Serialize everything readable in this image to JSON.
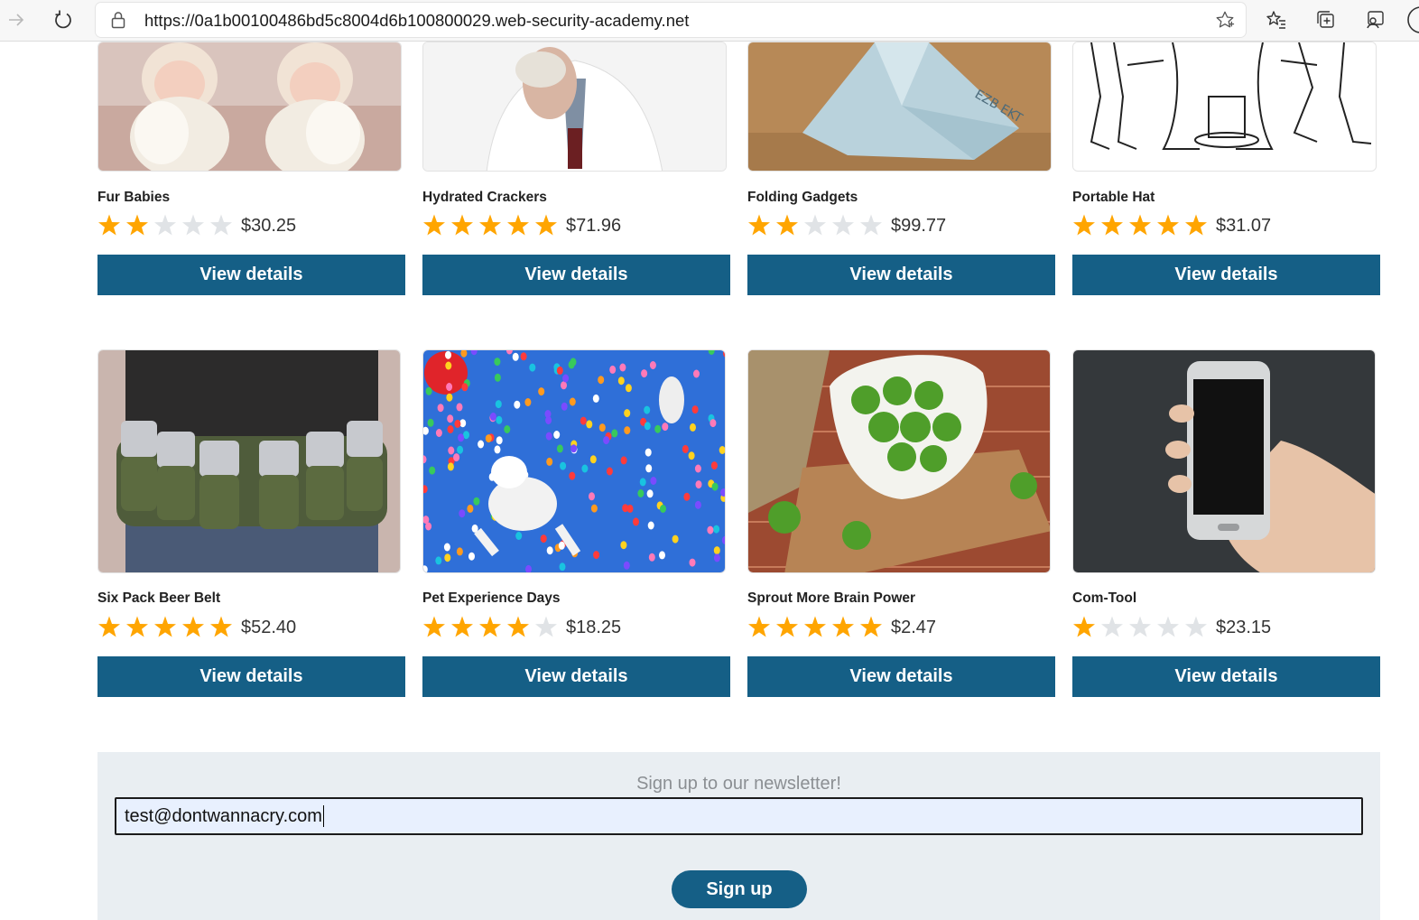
{
  "browser": {
    "url": "https://0a1b00100486bd5c8004d6b100800029.web-security-academy.net"
  },
  "colors": {
    "button": "#155f86",
    "star_filled": "#ffa500",
    "star_empty": "#e0e3e6",
    "newsletter_bg": "#e9eef2"
  },
  "products": [
    {
      "name": "Fur Babies",
      "rating": 2,
      "price": "$30.25",
      "button": "View details",
      "image": "twin-babies-with-teddy-bears"
    },
    {
      "name": "Hydrated Crackers",
      "rating": 5,
      "price": "$71.96",
      "button": "View details",
      "image": "man-eating-cracker"
    },
    {
      "name": "Folding Gadgets",
      "rating": 2,
      "price": "$99.77",
      "button": "View details",
      "image": "origami-banknote"
    },
    {
      "name": "Portable Hat",
      "rating": 5,
      "price": "$31.07",
      "button": "View details",
      "image": "sketch-of-people-with-hat"
    },
    {
      "name": "Six Pack Beer Belt",
      "rating": 5,
      "price": "$52.40",
      "button": "View details",
      "image": "camo-beer-can-belt"
    },
    {
      "name": "Pet Experience Days",
      "rating": 4,
      "price": "$18.25",
      "button": "View details",
      "image": "dogs-flying-with-balloons"
    },
    {
      "name": "Sprout More Brain Power",
      "rating": 5,
      "price": "$2.47",
      "button": "View details",
      "image": "bowl-of-brussels-sprouts"
    },
    {
      "name": "Com-Tool",
      "rating": 1,
      "price": "$23.15",
      "button": "View details",
      "image": "hand-holding-smartphone"
    }
  ],
  "newsletter": {
    "title": "Sign up to our newsletter!",
    "email_value": "test@dontwannacry.com",
    "button": "Sign up"
  }
}
